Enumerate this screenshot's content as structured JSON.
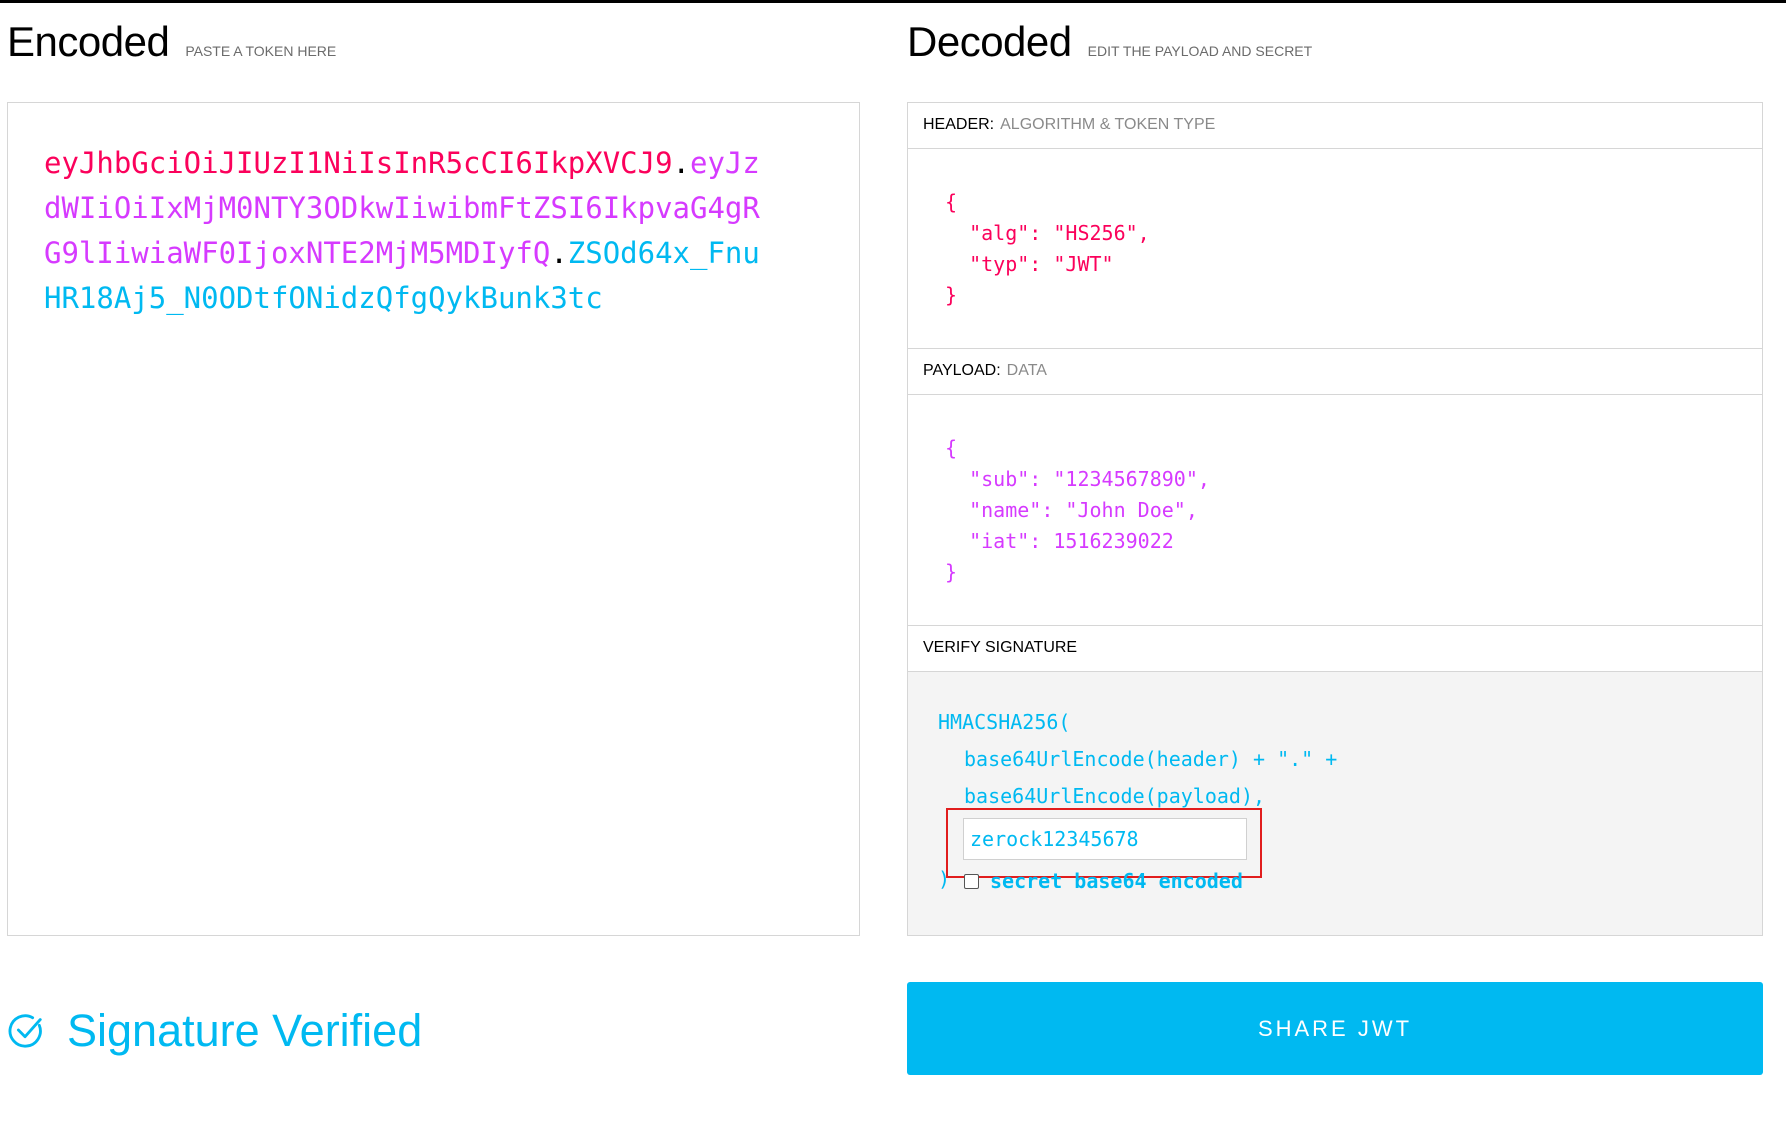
{
  "encoded": {
    "title": "Encoded",
    "subtitle": "PASTE A TOKEN HERE",
    "token_header": "eyJhbGciOiJIUzI1NiIsInR5cCI6IkpXVCJ9",
    "token_payload": "eyJzdWIiOiIxMjM0NTY3ODkwIiwibmFtZSI6IkpvaG4gRG9lIiwiaWF0IjoxNTE2MjM5MDIyfQ",
    "token_signature": "ZSOd64x_FnuHR18Aj5_N0ODtfONidzQfgQykBunk3tc",
    "dot": "."
  },
  "decoded": {
    "title": "Decoded",
    "subtitle": "EDIT THE PAYLOAD AND SECRET",
    "header_panel": {
      "label": "HEADER:",
      "sub": "ALGORITHM & TOKEN TYPE",
      "json": "{\n  \"alg\": \"HS256\",\n  \"typ\": \"JWT\"\n}"
    },
    "payload_panel": {
      "label": "PAYLOAD:",
      "sub": "DATA",
      "json": "{\n  \"sub\": \"1234567890\",\n  \"name\": \"John Doe\",\n  \"iat\": 1516239022\n}"
    },
    "verify_panel": {
      "label": "VERIFY SIGNATURE",
      "line1": "HMACSHA256(",
      "line2": "base64UrlEncode(header) + \".\" +",
      "line3": "base64UrlEncode(payload),",
      "secret_value": "zerock12345678",
      "close_paren": ")",
      "checkbox_label": "secret base64 encoded",
      "checkbox_checked": false
    }
  },
  "status": {
    "icon": "check-circle-icon",
    "text": "Signature Verified"
  },
  "share_button": "SHARE JWT",
  "colors": {
    "header": "#fb015b",
    "payload": "#d63aff",
    "signature": "#00b9f1",
    "highlight": "#e11d1d"
  }
}
